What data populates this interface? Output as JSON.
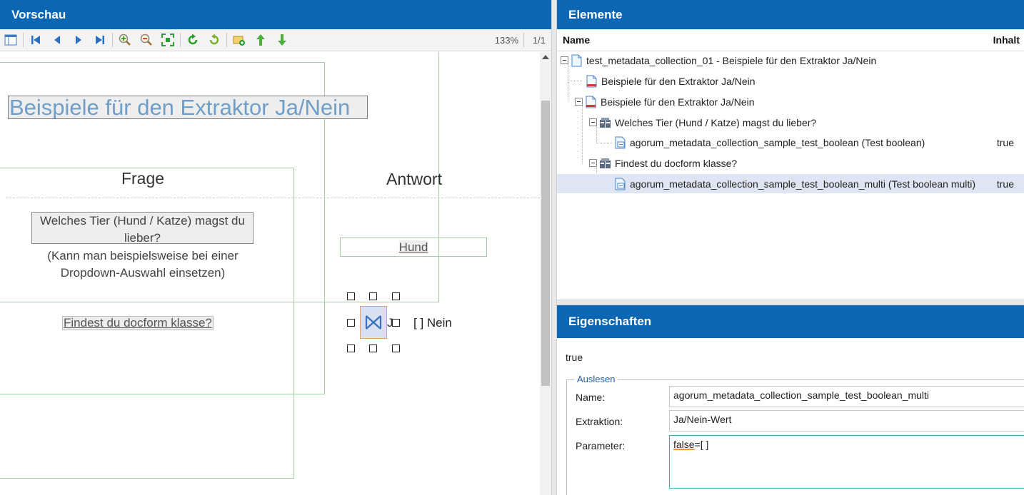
{
  "left_panel": {
    "title": "Vorschau",
    "toolbar": {
      "zoom": "133%",
      "page": "1/1",
      "buttons": [
        "layout-icon",
        "first-page-icon",
        "prev-page-icon",
        "next-page-icon",
        "last-page-icon",
        "zoom-in-icon",
        "zoom-out-icon",
        "fit-page-icon",
        "rotate-cw-icon",
        "rotate-ccw-icon",
        "add-element-icon",
        "move-up-icon",
        "move-down-icon"
      ]
    },
    "preview": {
      "doc_title": "Beispiele für den Extraktor Ja/Nein",
      "col_question": "Frage",
      "col_answer": "Antwort",
      "question_1": "Welches Tier (Hund / Katze) magst du lieber?",
      "question_1_note": "(Kann man beispielsweise bei einer Dropdown-Auswahl einsetzen)",
      "answer_1": "Hund",
      "question_2": "Findest du docform klasse?",
      "answer_2_fragment": "J",
      "answer_2_option": "[ ] Nein"
    }
  },
  "elements_panel": {
    "title": "Elemente",
    "col_name": "Name",
    "col_content": "Inhalt",
    "rows": [
      {
        "label": "test_metadata_collection_01 - Beispiele für den Extraktor Ja/Nein",
        "value": ""
      },
      {
        "label": "Beispiele für den Extraktor Ja/Nein",
        "value": ""
      },
      {
        "label": "Beispiele für den Extraktor Ja/Nein",
        "value": ""
      },
      {
        "label": "Welches Tier (Hund / Katze) magst du lieber?",
        "value": ""
      },
      {
        "label": "agorum_metadata_collection_sample_test_boolean (Test boolean)",
        "value": "true"
      },
      {
        "label": "Findest du docform klasse?",
        "value": ""
      },
      {
        "label": "agorum_metadata_collection_sample_test_boolean_multi (Test boolean multi)",
        "value": "true"
      }
    ]
  },
  "properties_panel": {
    "title": "Eigenschaften",
    "value": "true",
    "group_label": "Auslesen",
    "name_label": "Name:",
    "name_value": "agorum_metadata_collection_sample_test_boolean_multi",
    "extraction_label": "Extraktion:",
    "extraction_value": "Ja/Nein-Wert",
    "parameter_label": "Parameter:",
    "parameter_value_part1": "false",
    "parameter_value_part2": "=[ ]"
  },
  "colors": {
    "header_blue": "#0b67b3",
    "frame_green": "#9fd39f",
    "title_blue": "#6f9ec8",
    "selected_row": "#dfe6f3"
  }
}
